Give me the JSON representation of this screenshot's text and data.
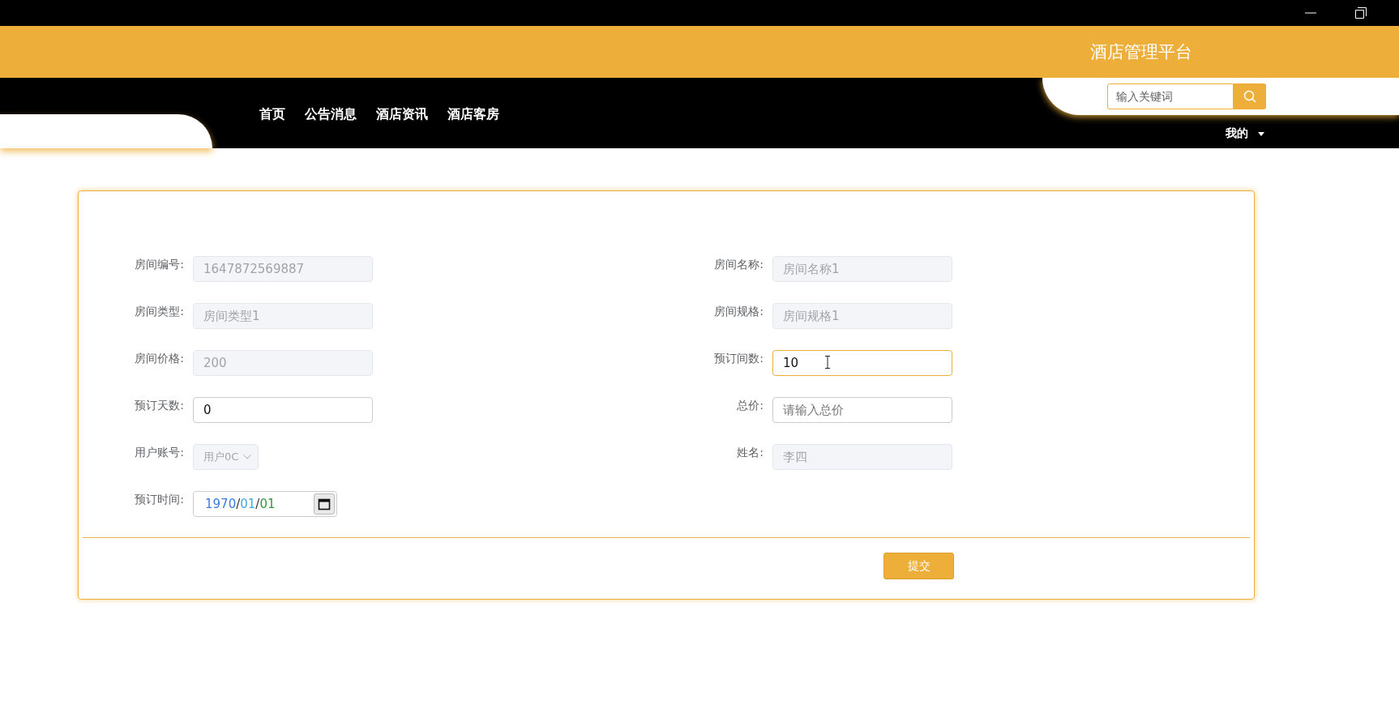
{
  "header": {
    "title": "酒店管理平台"
  },
  "nav": {
    "items": [
      {
        "label": "首页"
      },
      {
        "label": "公告消息"
      },
      {
        "label": "酒店资讯"
      },
      {
        "label": "酒店客房"
      }
    ],
    "search": {
      "placeholder": "输入关键词"
    },
    "user_menu": {
      "label": "我的"
    }
  },
  "form": {
    "fields": [
      {
        "label": "房间编号:",
        "kind": "input",
        "value": "1647872569887",
        "disabled": true,
        "focused": false
      },
      {
        "label": "房间名称:",
        "kind": "input",
        "value": "房间名称1",
        "disabled": true,
        "focused": false
      },
      {
        "label": "房间类型:",
        "kind": "input",
        "value": "房间类型1",
        "disabled": true,
        "focused": false
      },
      {
        "label": "房间规格:",
        "kind": "input",
        "value": "房间规格1",
        "disabled": true,
        "focused": false
      },
      {
        "label": "房间价格:",
        "kind": "input",
        "value": "200",
        "disabled": true,
        "focused": false
      },
      {
        "label": "预订间数:",
        "kind": "input",
        "value": "10",
        "disabled": false,
        "focused": true
      },
      {
        "label": "预订天数:",
        "kind": "input",
        "value": "0",
        "disabled": false,
        "focused": false
      },
      {
        "label": "总价:",
        "kind": "input",
        "placeholder": "请输入总价",
        "disabled": false,
        "focused": false
      },
      {
        "label": "用户账号:",
        "kind": "select",
        "value": "用户0C",
        "disabled": true,
        "focused": false
      },
      {
        "label": "姓名:",
        "kind": "input",
        "value": "李四",
        "disabled": true,
        "focused": false
      },
      {
        "label": "预订时间:",
        "kind": "date",
        "parts": [
          {
            "text": "1970",
            "color": "#3a7be0"
          },
          {
            "text": "/",
            "color": "#333333"
          },
          {
            "text": "01",
            "color": "#3fa9e0"
          },
          {
            "text": "/",
            "color": "#333333"
          },
          {
            "text": "01",
            "color": "#2e9a3a"
          }
        ],
        "disabled": false,
        "focused": false
      }
    ],
    "submit": "提交"
  }
}
